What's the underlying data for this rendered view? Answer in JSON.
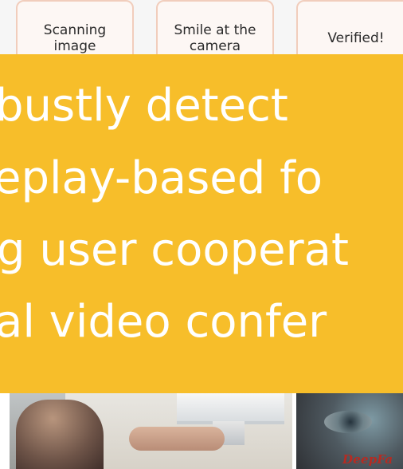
{
  "steps": [
    {
      "label": "Scanning\nimage"
    },
    {
      "label": "Smile at the\ncamera"
    },
    {
      "label": "Verified!"
    }
  ],
  "banner": {
    "lines": [
      "bustly detect",
      "eplay-based fo",
      "g user cooperat",
      "al video confer"
    ]
  },
  "photos": {
    "right_logo_text": "DeepFa"
  },
  "colors": {
    "banner_bg": "#f7be2a",
    "banner_text": "#ffffff",
    "step_border": "#f1cdbc",
    "step_bg": "#fdf7f4",
    "logo_red": "#b62b22"
  }
}
